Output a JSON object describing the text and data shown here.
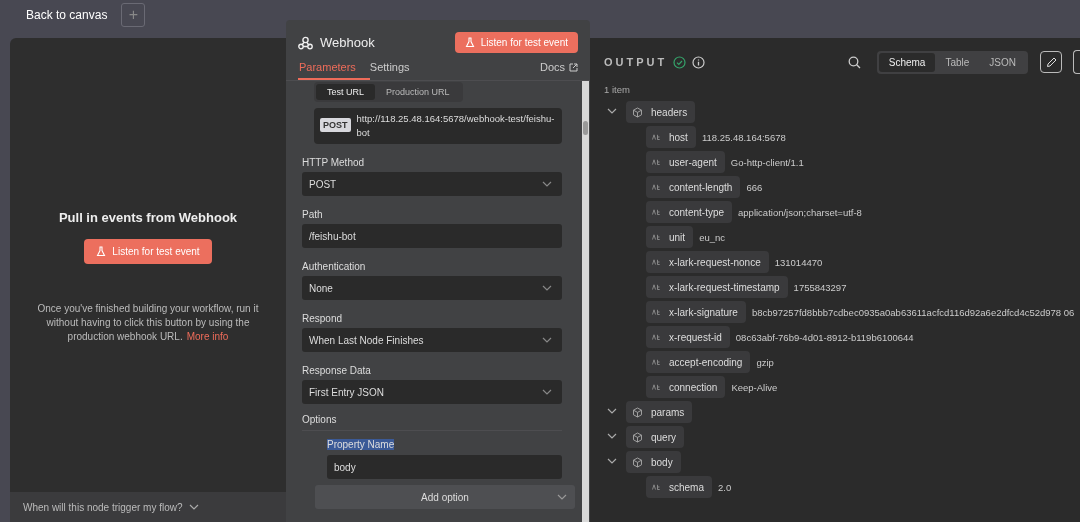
{
  "top_bar": {
    "back_label": "Back to canvas",
    "add_button": "+"
  },
  "left_panel": {
    "title": "Pull in events from Webhook",
    "listen_button": "Listen for test event",
    "description": "Once you've finished building your workflow, run it without having to click this button by using the production webhook URL.",
    "more_info_link": "More info",
    "footer_question": "When will this node trigger my flow?"
  },
  "node_panel": {
    "title": "Webhook",
    "listen_button": "Listen for test event",
    "tabs": [
      {
        "label": "Parameters",
        "selected": true
      },
      {
        "label": "Settings",
        "selected": false
      }
    ],
    "docs_link": "Docs",
    "url_tabs": [
      {
        "label": "Test URL",
        "selected": true
      },
      {
        "label": "Production URL",
        "selected": false
      }
    ],
    "url": {
      "method": "POST",
      "address": "http://118.25.48.164:5678/webhook-test/feishu-bot"
    },
    "fields": [
      {
        "label": "HTTP Method",
        "kind": "select",
        "value": "POST"
      },
      {
        "label": "Path",
        "kind": "input",
        "value": "/feishu-bot"
      },
      {
        "label": "Authentication",
        "kind": "select",
        "value": "None"
      },
      {
        "label": "Respond",
        "kind": "select",
        "value": "When Last Node Finishes"
      },
      {
        "label": "Response Data",
        "kind": "select",
        "value": "First Entry JSON"
      }
    ],
    "options_heading": "Options",
    "option_fields": [
      {
        "label": "Property Name",
        "value": "body"
      }
    ],
    "add_option_button": "Add option"
  },
  "output_panel": {
    "title": "OUTPUT",
    "views": [
      {
        "label": "Schema",
        "selected": true
      },
      {
        "label": "Table",
        "selected": false
      },
      {
        "label": "JSON",
        "selected": false
      }
    ],
    "item_count": "1 item",
    "tree": [
      {
        "key": "headers",
        "kind": "object",
        "expanded": true,
        "children": [
          {
            "key": "host",
            "kind": "string",
            "value": "118.25.48.164:5678"
          },
          {
            "key": "user-agent",
            "kind": "string",
            "value": "Go-http-client/1.1"
          },
          {
            "key": "content-length",
            "kind": "string",
            "value": "666"
          },
          {
            "key": "content-type",
            "kind": "string",
            "value": "application/json;charset=utf-8"
          },
          {
            "key": "unit",
            "kind": "string",
            "value": "eu_nc"
          },
          {
            "key": "x-lark-request-nonce",
            "kind": "string",
            "value": "131014470"
          },
          {
            "key": "x-lark-request-timestamp",
            "kind": "string",
            "value": "1755843297"
          },
          {
            "key": "x-lark-signature",
            "kind": "string",
            "value": "b8cb97257fd8bbb7cdbec0935a0ab63611acfcd116d92a6e2dfcd4c52d978 06"
          },
          {
            "key": "x-request-id",
            "kind": "string",
            "value": "08c63abf-76b9-4d01-8912-b119b6100644"
          },
          {
            "key": "accept-encoding",
            "kind": "string",
            "value": "gzip"
          },
          {
            "key": "connection",
            "kind": "string",
            "value": "Keep-Alive"
          }
        ]
      },
      {
        "key": "params",
        "kind": "object",
        "expanded": true
      },
      {
        "key": "query",
        "kind": "object",
        "expanded": true
      },
      {
        "key": "body",
        "kind": "object",
        "expanded": true,
        "children": [
          {
            "key": "schema",
            "kind": "string",
            "value": "2.0"
          }
        ]
      }
    ]
  }
}
